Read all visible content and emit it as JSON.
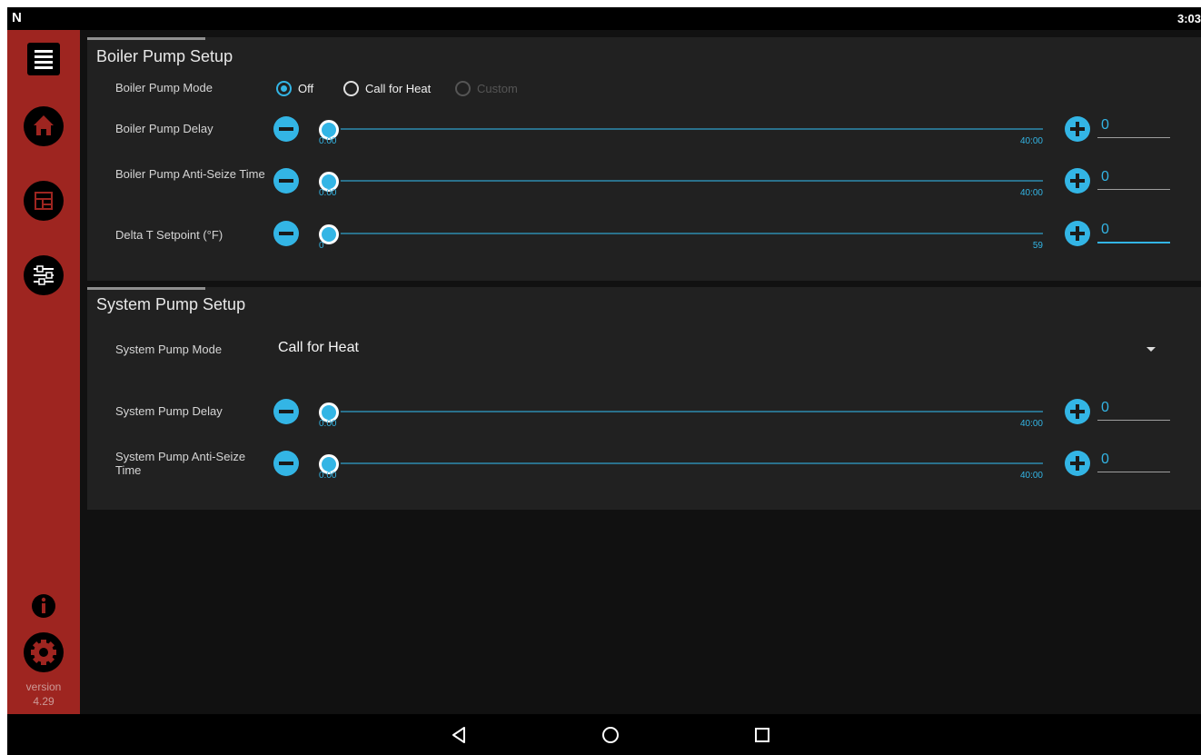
{
  "status_bar": {
    "logo": "N",
    "time": "3:03"
  },
  "sidebar": {
    "items": [
      {
        "icon": "menu-icon"
      },
      {
        "icon": "home-icon"
      },
      {
        "icon": "dashboard-icon"
      },
      {
        "icon": "sliders-icon"
      },
      {
        "icon": "info-icon"
      },
      {
        "icon": "gear-icon"
      }
    ],
    "version_label": "version",
    "version_number": "4.29"
  },
  "boiler": {
    "title": "Boiler Pump Setup",
    "mode": {
      "label": "Boiler Pump Mode",
      "options": [
        {
          "label": "Off",
          "checked": true,
          "enabled": true
        },
        {
          "label": "Call for Heat",
          "checked": false,
          "enabled": true
        },
        {
          "label": "Custom",
          "checked": false,
          "enabled": false
        }
      ]
    },
    "delay": {
      "label": "Boiler Pump Delay",
      "min": "0:00",
      "max": "40:00",
      "value": "0",
      "position": 0
    },
    "anti_seize": {
      "label": "Boiler Pump Anti-Seize Time",
      "min": "0:00",
      "max": "40:00",
      "value": "0",
      "position": 0
    },
    "delta_t": {
      "label": "Delta T Setpoint (°F)",
      "min": "0",
      "max": "59",
      "value": "0",
      "position": 0
    }
  },
  "system": {
    "title": "System Pump Setup",
    "mode": {
      "label": "System Pump Mode",
      "value": "Call for Heat"
    },
    "delay": {
      "label": "System Pump Delay",
      "min": "0:00",
      "max": "40:00",
      "value": "0",
      "position": 0
    },
    "anti_seize": {
      "label": "System Pump Anti-Seize Time",
      "min": "0:00",
      "max": "40:00",
      "value": "0",
      "position": 0
    }
  },
  "navbar": {
    "buttons": [
      "back-icon",
      "home-circle-icon",
      "recents-icon"
    ]
  },
  "colors": {
    "accent": "#33b5e5",
    "sidebar": "#9e2520",
    "panel": "#212121",
    "background": "#111111"
  }
}
